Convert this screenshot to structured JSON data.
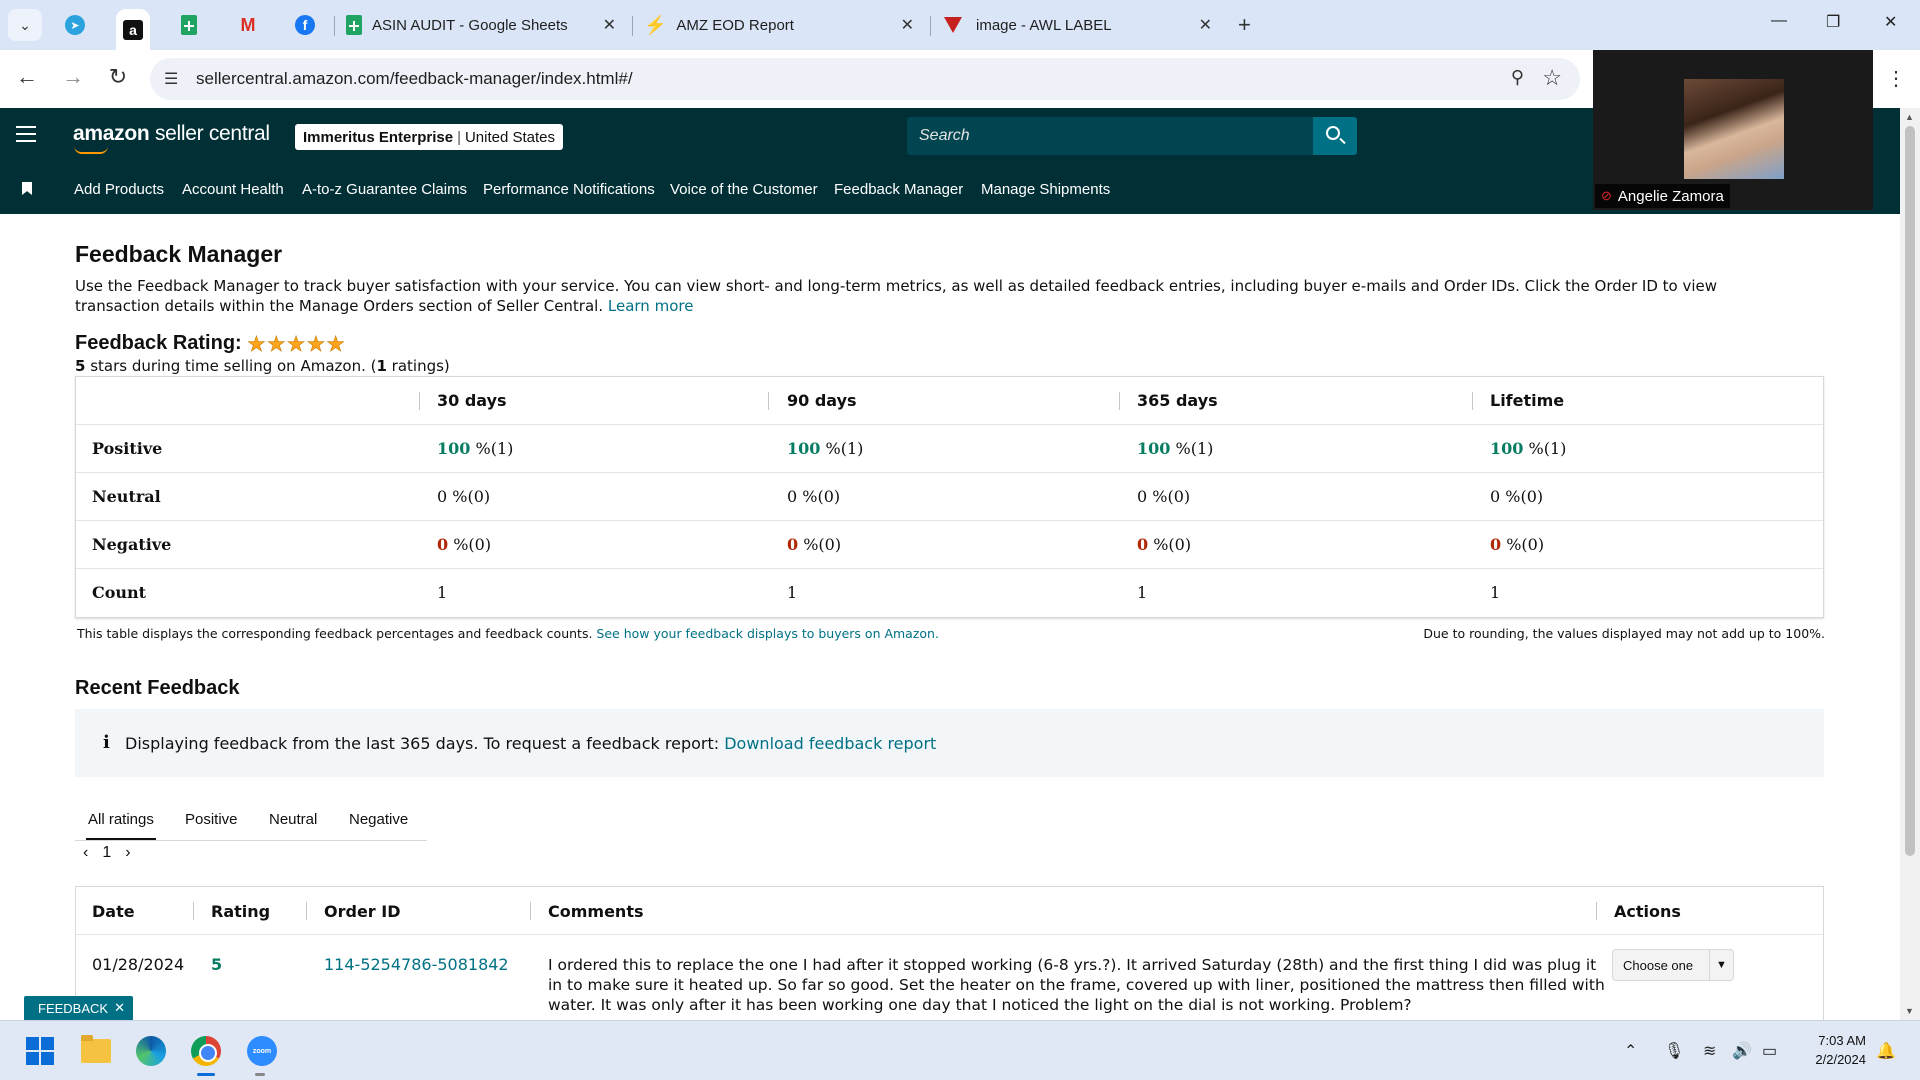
{
  "browser": {
    "tabs": [
      {
        "title": "ASIN AUDIT - Google Sheets",
        "icon": "google-sheets-icon"
      },
      {
        "title": "AMZ EOD Report",
        "icon": "amz-eod-icon"
      },
      {
        "title": "image - AWL LABEL",
        "icon": "awl-label-icon"
      }
    ],
    "url": "sellercentral.amazon.com/feedback-manager/index.html#/"
  },
  "header": {
    "logo_main": "amazon",
    "logo_sub": "seller central",
    "account_name": "Immeritus Enterprise",
    "account_divider": "|",
    "account_region": "United States",
    "search_placeholder": "Search"
  },
  "nav": {
    "items": [
      "Add Products",
      "Account Health",
      "A-to-z Guarantee Claims",
      "Performance Notifications",
      "Voice of the Customer",
      "Feedback Manager",
      "Manage Shipments"
    ]
  },
  "page": {
    "title": "Feedback Manager",
    "description": "Use the Feedback Manager to track buyer satisfaction with your service. You can view short- and long-term metrics, as well as detailed feedback entries, including buyer e-mails and Order IDs. Click the Order ID to view transaction details within the Manage Orders section of Seller Central.",
    "learn_more": "Learn more",
    "rating_title": "Feedback Rating:",
    "stars": 5,
    "stars_glyphs": "★★★★★",
    "rating_sub_stars": "5",
    "rating_sub_text": " stars during time selling on Amazon. (",
    "rating_sub_count": "1",
    "rating_sub_suffix": " ratings)"
  },
  "metrics": {
    "columns": [
      "30 days",
      "90 days",
      "365 days",
      "Lifetime"
    ],
    "rows": [
      {
        "label": "Positive",
        "cells": [
          [
            "100",
            " %(1)"
          ],
          [
            "100",
            " %(1)"
          ],
          [
            "100",
            " %(1)"
          ],
          [
            "100",
            " %(1)"
          ]
        ]
      },
      {
        "label": "Neutral",
        "cells": [
          [
            "0",
            " %(0)"
          ],
          [
            "0",
            " %(0)"
          ],
          [
            "0",
            " %(0)"
          ],
          [
            "0",
            " %(0)"
          ]
        ]
      },
      {
        "label": "Negative",
        "cells": [
          [
            "0",
            " %(0)"
          ],
          [
            "0",
            " %(0)"
          ],
          [
            "0",
            " %(0)"
          ],
          [
            "0",
            " %(0)"
          ]
        ]
      },
      {
        "label": "Count",
        "cells": [
          [
            "1",
            ""
          ],
          [
            "1",
            ""
          ],
          [
            "1",
            ""
          ],
          [
            "1",
            ""
          ]
        ]
      }
    ],
    "note_left": "This table displays the corresponding feedback percentages and feedback counts.",
    "note_link": "See how your feedback displays to buyers on Amazon.",
    "note_right": "Due to rounding, the values displayed may not add up to 100%."
  },
  "recent": {
    "title": "Recent Feedback",
    "info_icon": "i",
    "info_text": "Displaying feedback from the last 365 days. To request a feedback report:",
    "info_link": "Download feedback report",
    "tabs": [
      "All ratings",
      "Positive",
      "Neutral",
      "Negative"
    ],
    "page": "1",
    "headers": [
      "Date",
      "Rating",
      "Order ID",
      "Comments",
      "Actions"
    ],
    "rows": [
      {
        "date": "01/28/2024",
        "rating": "5",
        "order_id": "114-5254786-5081842",
        "comment": "I ordered this to replace the one I had after it stopped working (6-8 yrs.?). It arrived Saturday (28th) and the first thing I did was plug it in to make sure it heated up. So far so good. Set the heater on the frame, covered up with liner, positioned the mattress then filled with water. It was only after it has been working one day that I noticed the light on the dial is not working. Problem?",
        "action": "Choose one"
      }
    ]
  },
  "feedback_pill": "FEEDBACK",
  "zoom": {
    "participant": "Angelie Zamora"
  },
  "taskbar": {
    "time": "7:03 AM",
    "date": "2/2/2024"
  },
  "colors": {
    "header_bg": "#002f36",
    "accent_teal": "#007185",
    "positive_green": "#067d62",
    "negative_red": "#b12704",
    "star_orange": "#ffa41c"
  }
}
